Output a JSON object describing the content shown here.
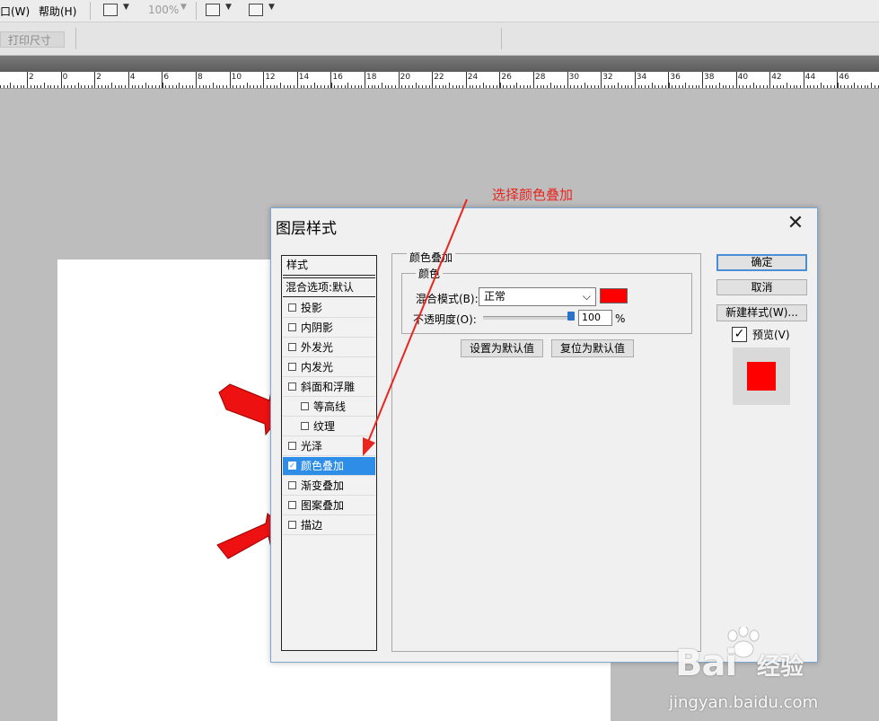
{
  "menu": {
    "window": "口(W)",
    "help": "帮助(H)",
    "zoom": "100%"
  },
  "options_bar": {
    "print_size": "打印尺寸"
  },
  "ruler": {
    "labels": [
      "2",
      "0",
      "2",
      "4",
      "6",
      "8",
      "10",
      "12",
      "14",
      "16",
      "18",
      "20",
      "22",
      "24",
      "26",
      "28",
      "30",
      "32",
      "34",
      "36",
      "38",
      "40",
      "42",
      "44",
      "46"
    ]
  },
  "annotation": {
    "text": "选择颜色叠加",
    "color": "#e8261f"
  },
  "dialog": {
    "title": "图层样式",
    "list_header": "样式",
    "blend_default": "混合选项:默认",
    "items": [
      {
        "label": "投影",
        "checked": false,
        "indent": false
      },
      {
        "label": "内阴影",
        "checked": false,
        "indent": false
      },
      {
        "label": "外发光",
        "checked": false,
        "indent": false
      },
      {
        "label": "内发光",
        "checked": false,
        "indent": false
      },
      {
        "label": "斜面和浮雕",
        "checked": false,
        "indent": false
      },
      {
        "label": "等高线",
        "checked": false,
        "indent": true
      },
      {
        "label": "纹理",
        "checked": false,
        "indent": true
      },
      {
        "label": "光泽",
        "checked": false,
        "indent": false
      },
      {
        "label": "颜色叠加",
        "checked": true,
        "indent": false,
        "selected": true
      },
      {
        "label": "渐变叠加",
        "checked": false,
        "indent": false
      },
      {
        "label": "图案叠加",
        "checked": false,
        "indent": false
      },
      {
        "label": "描边",
        "checked": false,
        "indent": false
      }
    ],
    "group_title": "颜色叠加",
    "inner_title": "颜色",
    "blend_mode_label": "混合模式(B):",
    "blend_mode_value": "正常",
    "overlay_color": "#ff0000",
    "opacity_label": "不透明度(O):",
    "opacity_value": "100",
    "opacity_level": 1.0,
    "percent": "%",
    "set_default": "设置为默认值",
    "reset_default": "复位为默认值",
    "ok": "确定",
    "cancel": "取消",
    "new_style": "新建样式(W)...",
    "preview_label": "预览(V)",
    "preview_checked": true
  },
  "watermark": {
    "brand": "Bai",
    "brand2": "经验",
    "url": "jingyan.baidu.com"
  }
}
